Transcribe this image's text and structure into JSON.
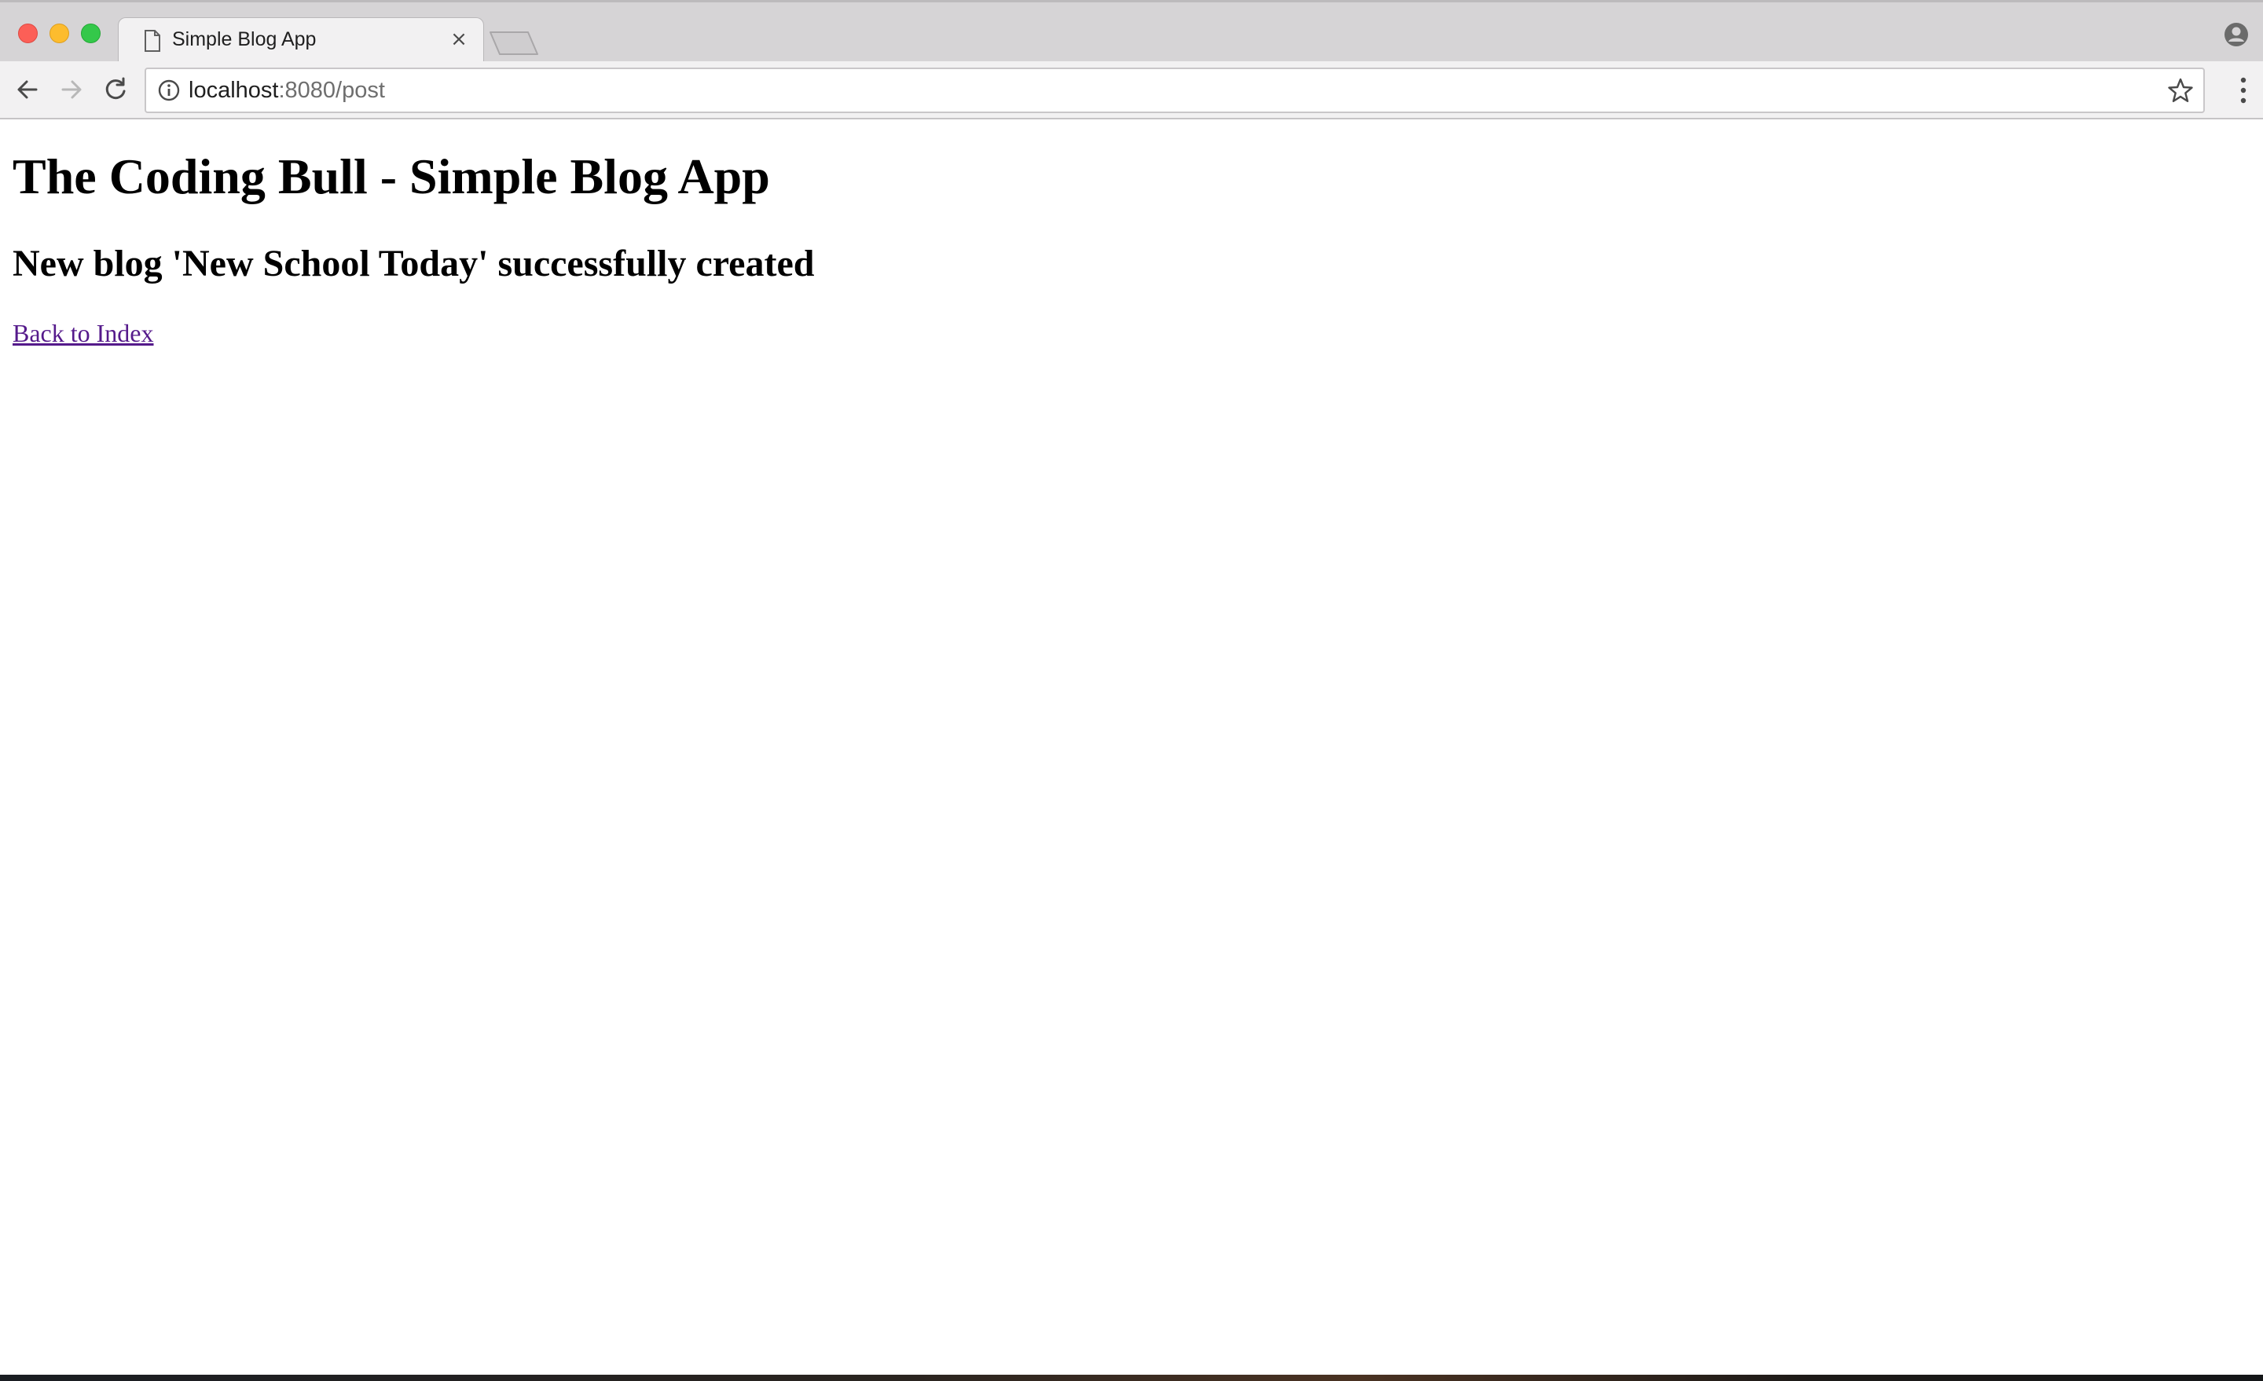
{
  "browser": {
    "tab": {
      "title": "Simple Blog App",
      "close_glyph": "×"
    },
    "address_bar": {
      "url_host": "localhost",
      "url_rest": ":8080/post"
    },
    "icons": {
      "tab_page": "page-icon",
      "new_tab": "new-tab-icon",
      "profile": "profile-icon",
      "back": "back-arrow-icon",
      "forward": "forward-arrow-icon",
      "reload": "reload-icon",
      "site_info": "info-icon",
      "bookmark": "star-icon",
      "menu": "menu-icon"
    },
    "colors": {
      "traffic_close": "#fc5f57",
      "traffic_minimize": "#fdbc2e",
      "traffic_maximize": "#34c84a",
      "visited_link": "#551a8b"
    }
  },
  "page": {
    "heading": "The Coding Bull - Simple Blog App",
    "message": "New blog 'New School Today' successfully created",
    "back_link": "Back to Index"
  }
}
